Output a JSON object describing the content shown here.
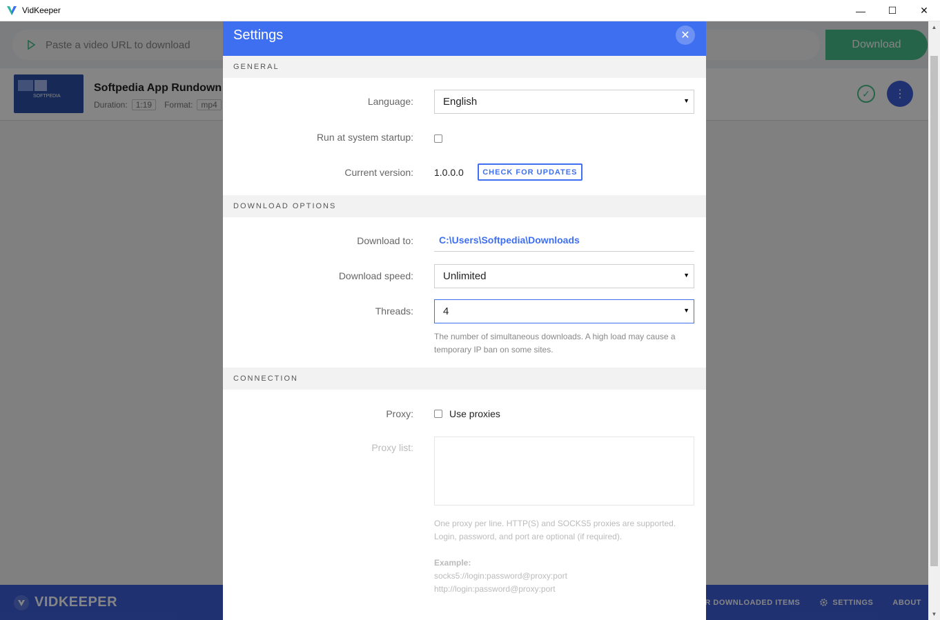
{
  "window": {
    "title": "VidKeeper",
    "controls": {
      "minimize": "—",
      "maximize": "☐",
      "close": "✕"
    }
  },
  "url_bar": {
    "placeholder": "Paste a video URL to download",
    "download_label": "Download"
  },
  "download_item": {
    "title": "Softpedia App Rundown",
    "duration_label": "Duration:",
    "duration": "1:19",
    "format_label": "Format:",
    "format": "mp4",
    "thumb_text": "SOFTPEDIA"
  },
  "footer": {
    "brand": "VIDKEEPER",
    "nav": {
      "downloaded": "R DOWNLOADED ITEMS",
      "settings": "SETTINGS",
      "about": "ABOUT"
    }
  },
  "settings": {
    "title": "Settings",
    "close_icon": "✕",
    "general": {
      "heading": "GENERAL",
      "language_label": "Language:",
      "language_value": "English",
      "startup_label": "Run at system startup:",
      "startup_checked": false,
      "version_label": "Current version:",
      "version_value": "1.0.0.0",
      "check_updates": "CHECK FOR UPDATES"
    },
    "download_options": {
      "heading": "DOWNLOAD OPTIONS",
      "download_to_label": "Download to:",
      "download_to_value": "C:\\Users\\Softpedia\\Downloads",
      "speed_label": "Download speed:",
      "speed_value": "Unlimited",
      "threads_label": "Threads:",
      "threads_value": "4",
      "threads_hint": "The number of simultaneous downloads. A high load may cause a temporary IP ban on some sites."
    },
    "connection": {
      "heading": "CONNECTION",
      "proxy_label": "Proxy:",
      "use_proxies": "Use proxies",
      "use_proxies_checked": false,
      "proxy_list_label": "Proxy list:",
      "proxy_hint": "One proxy per line. HTTP(S) and SOCKS5 proxies are supported. Login, password, and port are optional (if required).",
      "example_label": "Example:",
      "example_1": "socks5://login:password@proxy:port",
      "example_2": "http://login:password@proxy:port"
    }
  },
  "colors": {
    "accent": "#3d6ff0",
    "success": "#47c08b",
    "footer": "#3d5fd9"
  }
}
